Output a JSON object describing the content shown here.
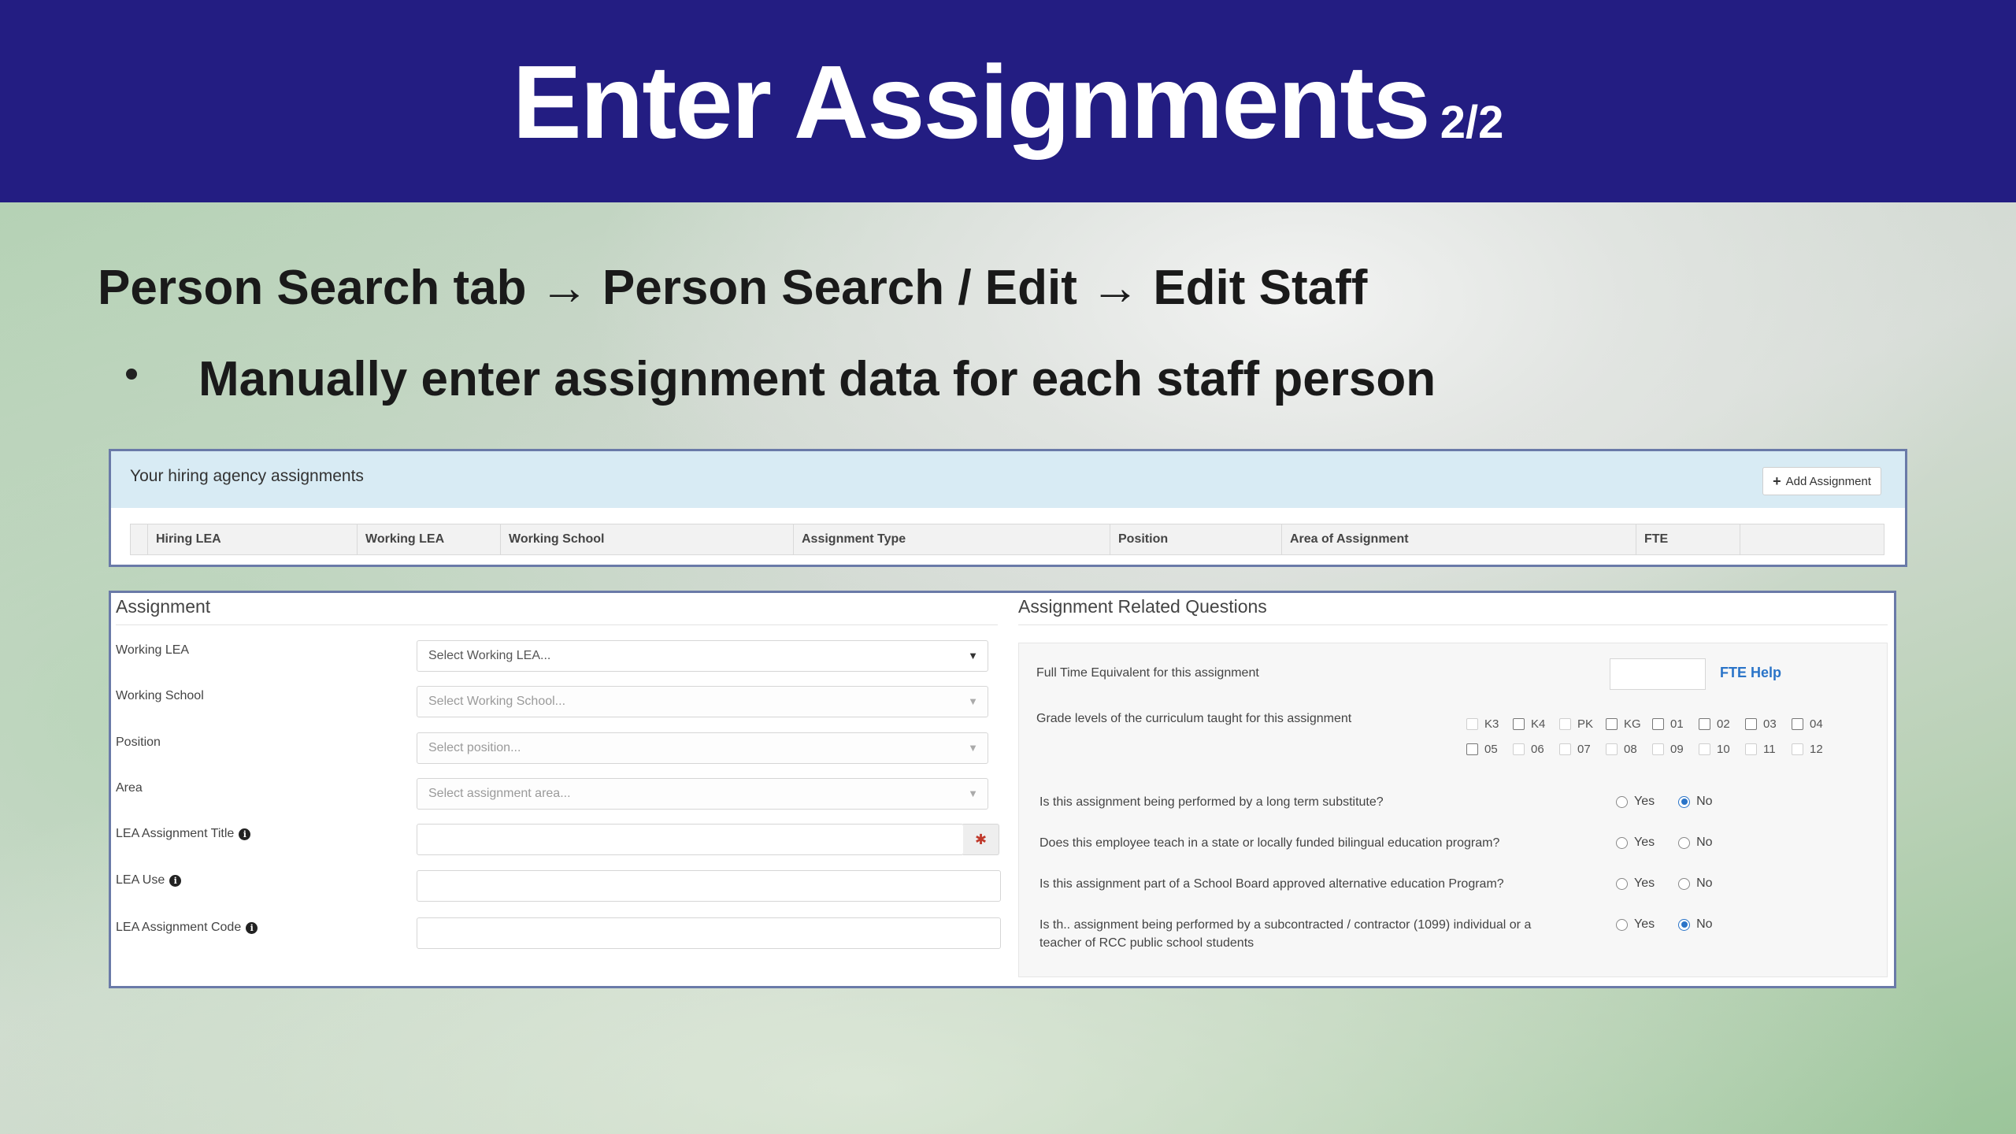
{
  "slide": {
    "title": "Enter Assignments",
    "title_suffix": "2/2",
    "breadcrumb": "Person Search tab → Person Search / Edit → Edit Staff",
    "bullet": "Manually enter assignment data for each staff person"
  },
  "hiring_panel": {
    "title": "Your hiring agency assignments",
    "add_button": "Add Assignment",
    "columns": [
      "Hiring LEA",
      "Working LEA",
      "Working School",
      "Assignment Type",
      "Position",
      "Area of Assignment",
      "FTE"
    ]
  },
  "assignment": {
    "title": "Assignment",
    "fields": {
      "working_lea": {
        "label": "Working LEA",
        "placeholder": "Select Working LEA..."
      },
      "working_school": {
        "label": "Working School",
        "placeholder": "Select Working School..."
      },
      "position": {
        "label": "Position",
        "placeholder": "Select position..."
      },
      "area": {
        "label": "Area",
        "placeholder": "Select assignment area..."
      },
      "lea_assignment_title": {
        "label": "LEA Assignment Title",
        "value": ""
      },
      "lea_use": {
        "label": "LEA Use",
        "value": ""
      },
      "lea_assignment_code": {
        "label": "LEA Assignment Code",
        "value": ""
      }
    }
  },
  "related_questions": {
    "title": "Assignment Related Questions",
    "fte_label": "Full Time Equivalent for this assignment",
    "fte_value": "",
    "fte_help": "FTE Help",
    "grades_label": "Grade levels of the curriculum taught for this assignment",
    "grades_row1": [
      "K3",
      "K4",
      "PK",
      "KG",
      "01",
      "02",
      "03",
      "04"
    ],
    "grades_row2": [
      "05",
      "06",
      "07",
      "08",
      "09",
      "10",
      "11",
      "12"
    ],
    "yes_label": "Yes",
    "no_label": "No",
    "questions": [
      {
        "text": "Is this assignment being performed by a long term substitute?",
        "selected": "No"
      },
      {
        "text": "Does this employee teach in a state or locally funded bilingual education program?",
        "selected": ""
      },
      {
        "text": "Is this assignment part of a School Board approved alternative education Program?",
        "selected": ""
      },
      {
        "text_line1": "Is th.. assignment being performed by a subcontracted / contractor (1099) individual or a",
        "text_line2": "teacher of RCC public school students",
        "selected": "No"
      }
    ]
  }
}
